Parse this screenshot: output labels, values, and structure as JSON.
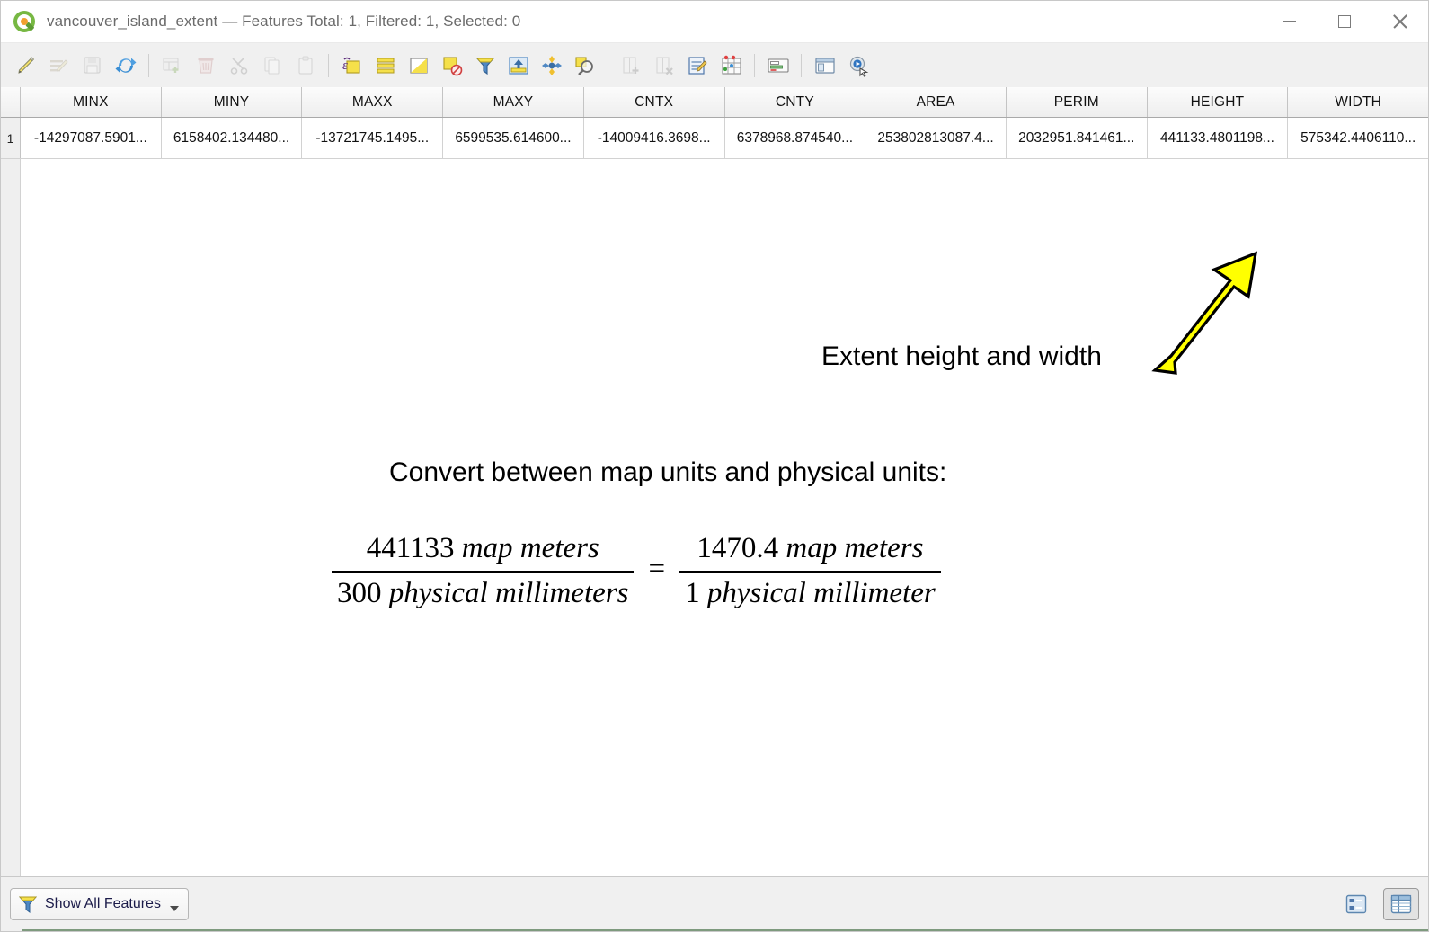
{
  "window": {
    "title": "vancouver_island_extent — Features Total: 1, Filtered: 1, Selected: 0",
    "app_icon": "qgis-logo-icon",
    "controls": {
      "minimize": "minimize-icon",
      "maximize": "maximize-icon",
      "close": "close-icon"
    }
  },
  "toolbar": {
    "items": [
      {
        "name": "toggle-editing-icon",
        "label": "Toggle editing mode",
        "enabled": true
      },
      {
        "name": "multi-edit-icon",
        "label": "Toggle multi edit mode",
        "enabled": false
      },
      {
        "name": "save-edits-icon",
        "label": "Save edits",
        "enabled": false
      },
      {
        "name": "reload-table-icon",
        "label": "Reload the table",
        "enabled": true
      },
      {
        "sep": true
      },
      {
        "name": "add-feature-icon",
        "label": "Add feature",
        "enabled": false
      },
      {
        "name": "delete-selected-icon",
        "label": "Delete selected features",
        "enabled": false
      },
      {
        "name": "cut-features-icon",
        "label": "Cut selected features to clipboard",
        "enabled": false
      },
      {
        "name": "copy-features-icon",
        "label": "Copy selected features to clipboard",
        "enabled": false
      },
      {
        "name": "paste-features-icon",
        "label": "Paste features from clipboard",
        "enabled": false
      },
      {
        "sep": true
      },
      {
        "name": "select-by-expression-icon",
        "label": "Select features using an expression",
        "enabled": true
      },
      {
        "name": "select-all-icon",
        "label": "Select all",
        "enabled": true
      },
      {
        "name": "invert-selection-icon",
        "label": "Invert selection",
        "enabled": true
      },
      {
        "name": "deselect-all-icon",
        "label": "Deselect all",
        "enabled": true
      },
      {
        "name": "filter-expression-icon",
        "label": "Filter features using form",
        "enabled": true
      },
      {
        "name": "move-selection-to-top-icon",
        "label": "Move selection to top",
        "enabled": true
      },
      {
        "name": "pan-to-selection-icon",
        "label": "Pan map to the selected rows",
        "enabled": true
      },
      {
        "name": "zoom-to-selection-icon",
        "label": "Zoom map to the selected rows",
        "enabled": true
      },
      {
        "sep": true
      },
      {
        "name": "new-field-icon",
        "label": "New field",
        "enabled": false
      },
      {
        "name": "delete-field-icon",
        "label": "Delete field",
        "enabled": false
      },
      {
        "name": "field-calculator-icon",
        "label": "Open field calculator",
        "enabled": true
      },
      {
        "name": "conditional-formatting-icon",
        "label": "Conditional formatting",
        "enabled": true
      },
      {
        "sep": true
      },
      {
        "name": "organize-columns-icon",
        "label": "Organize columns",
        "enabled": true
      },
      {
        "sep": true
      },
      {
        "name": "dock-window-icon",
        "label": "Dock attribute table",
        "enabled": true
      },
      {
        "name": "run-action-icon",
        "label": "Run feature action",
        "enabled": true
      }
    ]
  },
  "table": {
    "columns": [
      "MINX",
      "MINY",
      "MAXX",
      "MAXY",
      "CNTX",
      "CNTY",
      "AREA",
      "PERIM",
      "HEIGHT",
      "WIDTH"
    ],
    "rows": [
      {
        "id": "1",
        "cells": [
          "-14297087.5901...",
          "6158402.134480...",
          "-13721745.1495...",
          "6599535.614600...",
          "-14009416.3698...",
          "6378968.874540...",
          "253802813087.4...",
          "2032951.841461...",
          "441133.4801198...",
          "575342.4406110..."
        ]
      }
    ]
  },
  "annotation": {
    "callout_text": "Extent height and width",
    "arrow_color": "#ffff00",
    "arrow_outline": "#000000"
  },
  "formula": {
    "heading": "Convert between map units and physical units:",
    "left": {
      "numerator_value": "441133",
      "numerator_unit": "map meters",
      "denominator_value": "300",
      "denominator_unit": "physical millimeters"
    },
    "operator": "=",
    "right": {
      "numerator_value": "1470.4",
      "numerator_unit": "map meters",
      "denominator_value": "1",
      "denominator_unit": "physical millimeter"
    }
  },
  "statusbar": {
    "filter_label": "Show All Features",
    "filter_icon": "filter-funnel-icon",
    "views": [
      {
        "name": "form-view-icon",
        "label": "Switch to form view",
        "active": false
      },
      {
        "name": "table-view-icon",
        "label": "Switch to table view",
        "active": true
      }
    ]
  }
}
